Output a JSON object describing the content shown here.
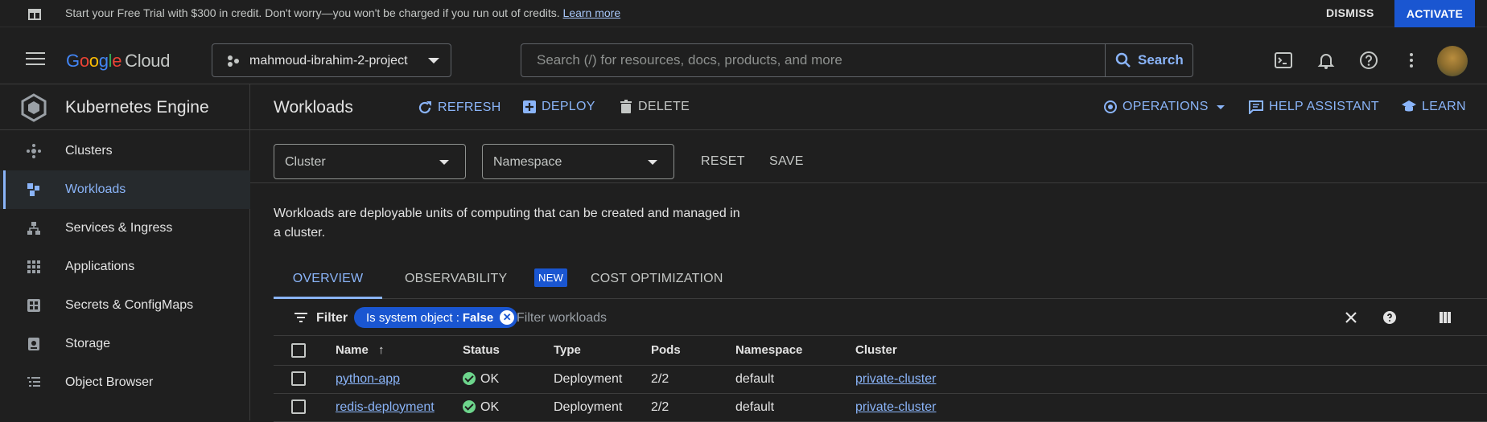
{
  "banner": {
    "message": "Start your Free Trial with $300 in credit. Don't worry—you won't be charged if you run out of credits.",
    "learn_more": "Learn more",
    "dismiss": "DISMISS",
    "activate": "ACTIVATE"
  },
  "topbar": {
    "logo_google": [
      "G",
      "o",
      "o",
      "g",
      "l",
      "e"
    ],
    "logo_cloud": "Cloud",
    "project": "mahmoud-ibrahim-2-project",
    "search_placeholder": "Search (/) for resources, docs, products, and more",
    "search_button": "Search"
  },
  "sidebar": {
    "title": "Kubernetes Engine",
    "items": [
      {
        "label": "Clusters",
        "icon": "clusters-icon"
      },
      {
        "label": "Workloads",
        "icon": "workloads-icon",
        "active": true
      },
      {
        "label": "Services & Ingress",
        "icon": "services-icon"
      },
      {
        "label": "Applications",
        "icon": "apps-grid-icon"
      },
      {
        "label": "Secrets & ConfigMaps",
        "icon": "secrets-icon"
      },
      {
        "label": "Storage",
        "icon": "storage-icon"
      },
      {
        "label": "Object Browser",
        "icon": "object-browser-icon"
      }
    ]
  },
  "actions": {
    "page_title": "Workloads",
    "refresh": "REFRESH",
    "deploy": "DEPLOY",
    "delete": "DELETE",
    "operations": "OPERATIONS",
    "help_assistant": "HELP ASSISTANT",
    "learn": "LEARN"
  },
  "filters": {
    "cluster": "Cluster",
    "namespace": "Namespace",
    "reset": "RESET",
    "save": "SAVE"
  },
  "description": "Workloads are deployable units of computing that can be created and managed in a cluster.",
  "tabs": {
    "overview": "OVERVIEW",
    "observability": "OBSERVABILITY",
    "observability_badge": "NEW",
    "cost": "COST OPTIMIZATION"
  },
  "filter_bar": {
    "label": "Filter",
    "chip_key": "Is system object :",
    "chip_value": "False",
    "placeholder": "Filter workloads"
  },
  "table": {
    "columns": [
      "Name",
      "Status",
      "Type",
      "Pods",
      "Namespace",
      "Cluster"
    ],
    "rows": [
      {
        "name": "python-app",
        "status": "OK",
        "type": "Deployment",
        "pods": "2/2",
        "namespace": "default",
        "cluster": "private-cluster"
      },
      {
        "name": "redis-deployment",
        "status": "OK",
        "type": "Deployment",
        "pods": "2/2",
        "namespace": "default",
        "cluster": "private-cluster"
      }
    ]
  },
  "colors": {
    "accent": "#8ab4f8",
    "brand_blue": "#1a56d1",
    "ok_green": "#6dd58c",
    "background": "#1f1f1f"
  }
}
